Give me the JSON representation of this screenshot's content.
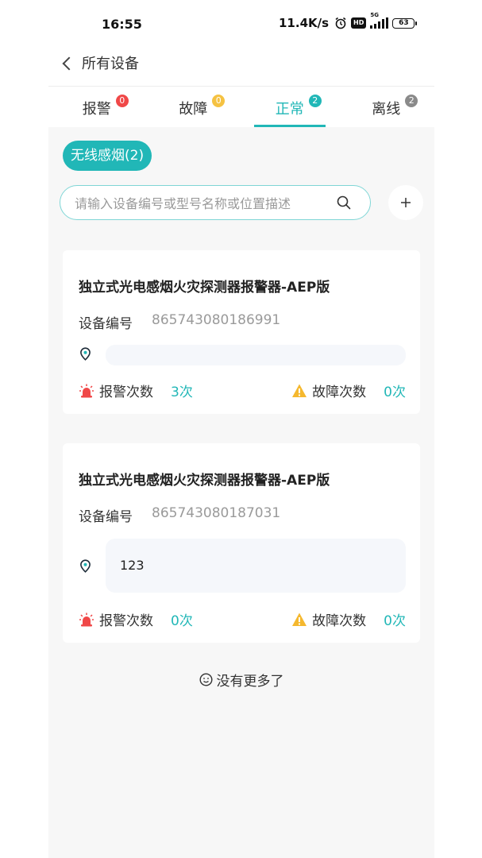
{
  "status_bar": {
    "time": "16:55",
    "net_speed": "11.4K/s",
    "hd_label": "HD",
    "network": "5G",
    "battery": "63"
  },
  "nav": {
    "back_title": "所有设备"
  },
  "tabs": [
    {
      "label": "报警",
      "count": "0",
      "badge_color": "#f04848",
      "active": false
    },
    {
      "label": "故障",
      "count": "0",
      "badge_color": "#f5c242",
      "active": false
    },
    {
      "label": "正常",
      "count": "2",
      "badge_color": "#21b7b7",
      "active": true
    },
    {
      "label": "离线",
      "count": "2",
      "badge_color": "#8a8a8a",
      "active": false
    }
  ],
  "filter_chip": "无线感烟(2)",
  "search": {
    "placeholder": "请输入设备编号或型号名称或位置描述",
    "value": ""
  },
  "code_label": "设备编号",
  "alarm_label": "报警次数",
  "fault_label": "故障次数",
  "devices": [
    {
      "title": "独立式光电感烟火灾探测器报警器-AEP版",
      "code": "865743080186991",
      "location": "",
      "alarm_count": "3次",
      "fault_count": "0次"
    },
    {
      "title": "独立式光电感烟火灾探测器报警器-AEP版",
      "code": "865743080187031",
      "location": "123",
      "alarm_count": "0次",
      "fault_count": "0次"
    }
  ],
  "footer": {
    "no_more": "没有更多了",
    "icon": "smile-icon"
  },
  "colors": {
    "accent": "#21b7b7",
    "alarm_red": "#f04848",
    "fault_yellow": "#f5c242",
    "offline_gray": "#8a8a8a"
  }
}
